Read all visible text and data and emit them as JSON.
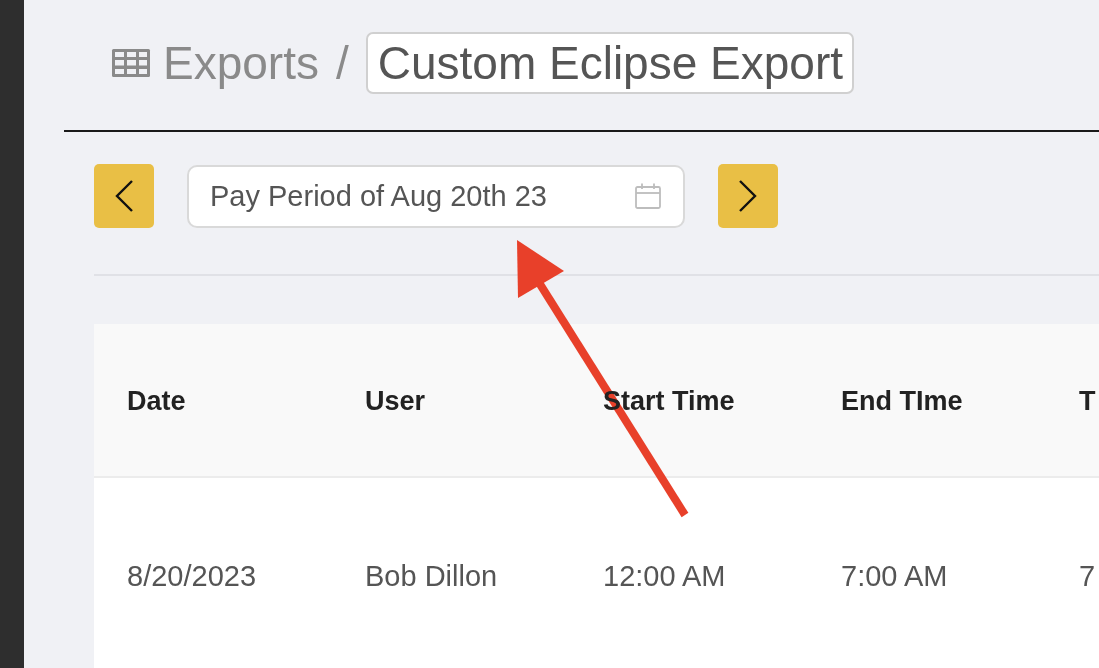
{
  "breadcrumb": {
    "section": "Exports",
    "separator": "/"
  },
  "title_field": {
    "value": "Custom Eclipse Export"
  },
  "period_nav": {
    "date_field": {
      "value": "Pay Period of Aug 20th 23"
    }
  },
  "table": {
    "columns": [
      "Date",
      "User",
      "Start Time",
      "End TIme",
      "T"
    ],
    "rows": [
      [
        "8/20/2023",
        "Bob Dillon",
        "12:00 AM",
        "7:00 AM",
        "7"
      ]
    ]
  }
}
